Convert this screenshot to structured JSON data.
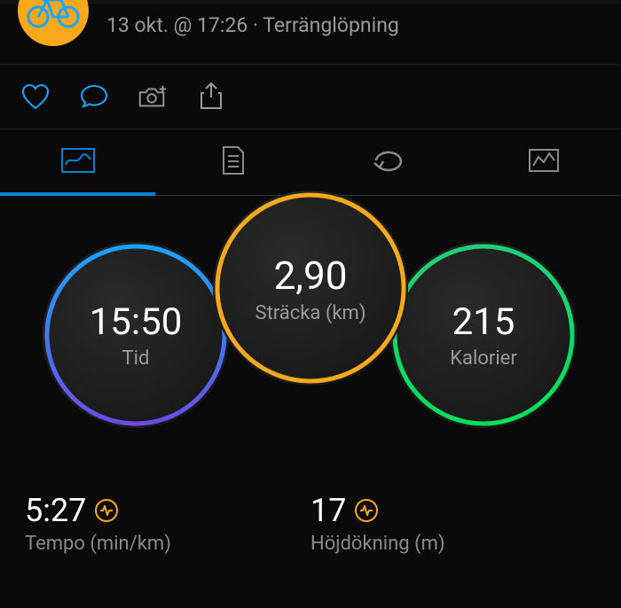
{
  "header": {
    "date_line": "13 okt. @ 17:26 · Terränglöpning"
  },
  "gauges": {
    "time": {
      "value": "15:50",
      "label": "Tid"
    },
    "distance": {
      "value": "2,90",
      "label": "Sträcka (km)"
    },
    "calories": {
      "value": "215",
      "label": "Kalorier"
    }
  },
  "stats": {
    "pace": {
      "value": "5:27",
      "label": "Tempo (min/km)"
    },
    "elevation": {
      "value": "17",
      "label": "Höjdökning (m)"
    }
  },
  "colors": {
    "accent_blue": "#0084d6",
    "ring_blue_top": "#1aa3ff",
    "ring_blue_bottom": "#6a4de6",
    "ring_orange": "#f7a81b",
    "ring_green_top": "#21d07a",
    "ring_green_bottom": "#00e05a"
  }
}
